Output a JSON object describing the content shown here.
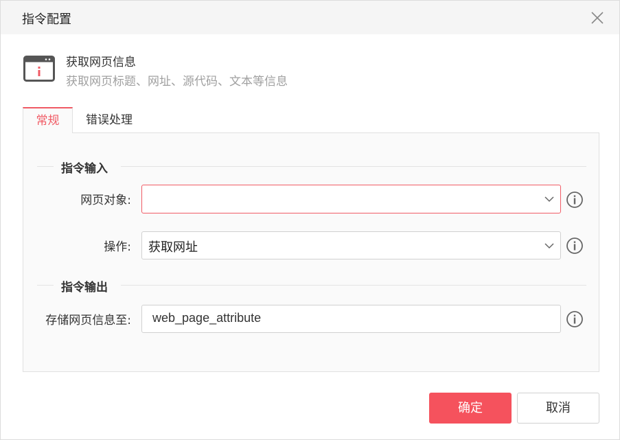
{
  "dialog": {
    "title": "指令配置"
  },
  "command": {
    "name": "获取网页信息",
    "description": "获取网页标题、网址、源代码、文本等信息"
  },
  "tabs": [
    {
      "label": "常规",
      "active": true
    },
    {
      "label": "错误处理",
      "active": false
    }
  ],
  "sections": {
    "input_title": "指令输入",
    "output_title": "指令输出"
  },
  "fields": {
    "web_object": {
      "label": "网页对象:",
      "value": ""
    },
    "operation": {
      "label": "操作:",
      "value": "获取网址"
    },
    "store_to": {
      "label": "存储网页信息至:",
      "value": "web_page_attribute"
    }
  },
  "buttons": {
    "ok": "确定",
    "cancel": "取消"
  },
  "colors": {
    "accent": "#f05a64",
    "primary_button": "#f5525d"
  },
  "icons": {
    "close": "close-icon",
    "command": "browser-info-icon",
    "info": "info-icon",
    "dropdown": "chevron-down-icon"
  }
}
